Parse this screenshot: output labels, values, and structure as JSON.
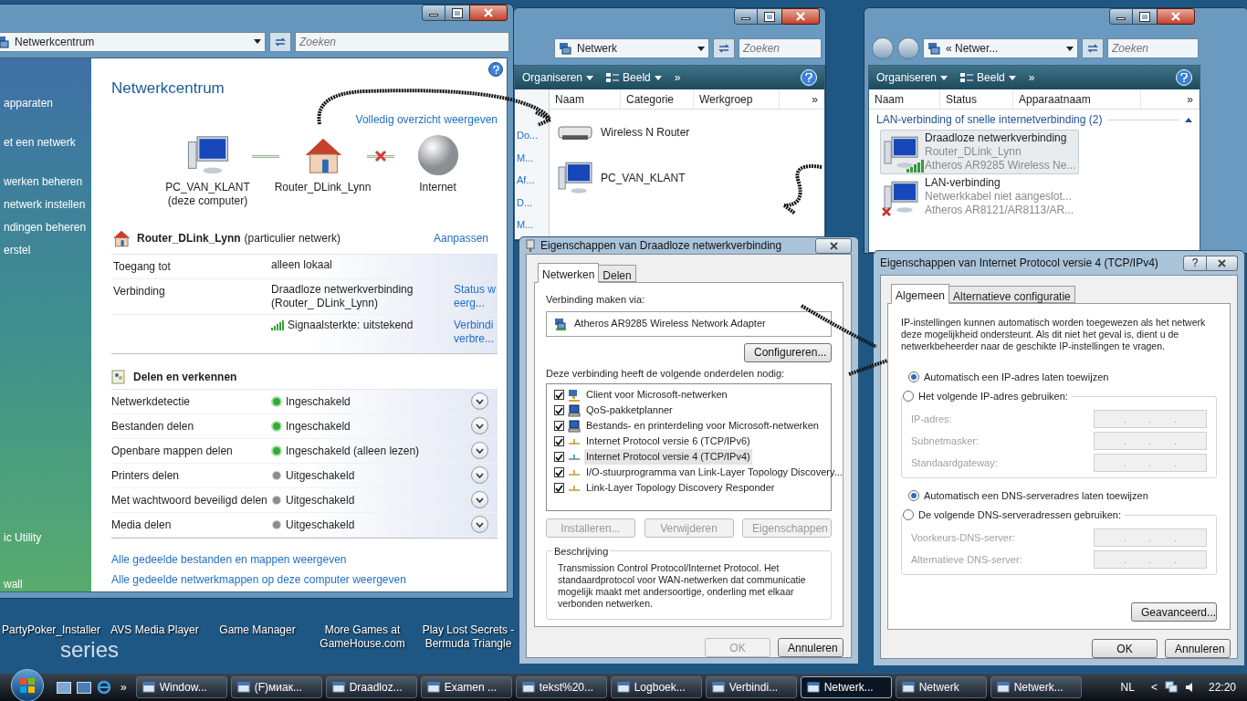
{
  "desktop": {
    "wallpaper_text": "series",
    "icons": [
      {
        "label": "PartyPoker_Installer"
      },
      {
        "label": "AVS Media Player"
      },
      {
        "label": "Game Manager"
      },
      {
        "label": "More Games at GameHouse.com"
      },
      {
        "label": "Play Lost Secrets - Bermuda Triangle"
      }
    ]
  },
  "network_center": {
    "address": "Netwerkcentrum",
    "search_placeholder": "Zoeken",
    "sidebar": [
      {
        "label": "apparaten"
      },
      {
        "label": "et een netwerk"
      },
      {
        "label": "werken beheren"
      },
      {
        "label": "netwerk instellen"
      },
      {
        "label": "ndingen beheren"
      },
      {
        "label": "erstel"
      },
      {
        "label": "ic Utility"
      },
      {
        "label": "wall"
      }
    ],
    "title": "Netwerkcentrum",
    "full_map_link": "Volledig overzicht weergeven",
    "map": [
      {
        "kind": "computer",
        "label": "PC_VAN_KLANT",
        "sublabel": "(deze computer)"
      },
      {
        "kind": "house",
        "label": "Router_DLink_Lynn",
        "link_ok": true
      },
      {
        "kind": "globe",
        "label": "Internet",
        "link_ok": false
      }
    ],
    "network": {
      "name": "Router_DLink_Lynn",
      "type": "(particulier netwerk)",
      "customize_link": "Aanpassen",
      "rows": [
        {
          "label": "Toegang tot",
          "value": "alleen lokaal"
        },
        {
          "label": "Verbinding",
          "value": "Draadloze netwerkverbinding (Router_ DLink_Lynn)",
          "link": "Status weerg..."
        },
        {
          "label": "",
          "value": "Signaalsterkte: uitstekend",
          "kind": "signal",
          "link": "Verbindi verbre..."
        }
      ]
    },
    "sharing_title": "Delen en verkennen",
    "sharing": [
      {
        "label": "Netwerkdetectie",
        "status": "Ingeschakeld",
        "on": true
      },
      {
        "label": "Bestanden delen",
        "status": "Ingeschakeld",
        "on": true
      },
      {
        "label": "Openbare mappen delen",
        "status": "Ingeschakeld (alleen lezen)",
        "on": true
      },
      {
        "label": "Printers delen",
        "status": "Uitgeschakeld",
        "on": false
      },
      {
        "label": "Met wachtwoord beveiligd delen",
        "status": "Uitgeschakeld",
        "on": false
      },
      {
        "label": "Media delen",
        "status": "Uitgeschakeld",
        "on": false
      }
    ],
    "links": [
      "Alle gedeelde bestanden en mappen weergeven",
      "Alle gedeelde netwerkmappen op deze computer weergeven"
    ]
  },
  "network_explorer": {
    "address": "Netwerk",
    "search_placeholder": "Zoeken",
    "toolbar": [
      "Organiseren",
      "Beeld",
      "»"
    ],
    "nav_items": [
      "Do...",
      "M...",
      "Af...",
      "D...",
      "M..."
    ],
    "columns": [
      "Naam",
      "Categorie",
      "Werkgroep",
      "»"
    ],
    "items": [
      {
        "kind": "router",
        "name": "Wireless N Router"
      },
      {
        "kind": "computer",
        "name": "PC_VAN_KLANT"
      }
    ]
  },
  "connections_explorer": {
    "address": "« Netwer...",
    "search_placeholder": "Zoeken",
    "toolbar": [
      "Organiseren",
      "Beeld",
      "»"
    ],
    "columns": [
      "Naam",
      "Status",
      "Apparaatnaam",
      "»"
    ],
    "group": "LAN-verbinding of snelle internetverbinding (2)",
    "items": [
      {
        "kind": "wireless",
        "name": "Draadloze netwerkverbinding",
        "line2": "Router_DLink_Lynn",
        "line3": "Atheros AR9285 Wireless Ne...",
        "selected": true,
        "connected": true
      },
      {
        "kind": "wired",
        "name": "LAN-verbinding",
        "line2": "Netwerkkabel niet aangeslot...",
        "line3": "Atheros AR8121/AR8113/AR...",
        "selected": false,
        "connected": false
      }
    ]
  },
  "adapter_dialog": {
    "title": "Eigenschappen van Draadloze netwerkverbinding",
    "tabs": [
      {
        "label": "Netwerken",
        "selected": true
      },
      {
        "label": "Delen",
        "selected": false
      }
    ],
    "connect_label": "Verbinding maken via:",
    "adapter": "Atheros AR9285 Wireless Network Adapter",
    "configure_button": "Configureren...",
    "components_label": "Deze verbinding heeft de volgende onderdelen nodig:",
    "components": [
      {
        "kind": "client",
        "label": "Client voor Microsoft-netwerken",
        "checked": true,
        "selected": false
      },
      {
        "kind": "service",
        "label": "QoS-pakketplanner",
        "checked": true,
        "selected": false
      },
      {
        "kind": "service",
        "label": "Bestands- en printerdeling voor Microsoft-netwerken",
        "checked": true,
        "selected": false
      },
      {
        "kind": "protocol",
        "label": "Internet Protocol versie 6 (TCP/IPv6)",
        "checked": true,
        "selected": false
      },
      {
        "kind": "protocol",
        "label": "Internet Protocol versie 4 (TCP/IPv4)",
        "checked": true,
        "selected": true
      },
      {
        "kind": "protocol",
        "label": "I/O-stuurprogramma van Link-Layer Topology Discovery...",
        "checked": true,
        "selected": false
      },
      {
        "kind": "protocol",
        "label": "Link-Layer Topology Discovery Responder",
        "checked": true,
        "selected": false
      }
    ],
    "buttons": [
      {
        "label": "Installeren...",
        "disabled": true
      },
      {
        "label": "Verwijderen",
        "disabled": true
      },
      {
        "label": "Eigenschappen",
        "disabled": true
      }
    ],
    "description_title": "Beschrijving",
    "description": "Transmission Control Protocol/Internet Protocol. Het standaardprotocol voor WAN-netwerken dat communicatie mogelijk maakt met andersoortige, onderling met elkaar verbonden netwerken.",
    "footer": [
      {
        "label": "OK",
        "disabled": true
      },
      {
        "label": "Annuleren",
        "disabled": false
      }
    ]
  },
  "ip_dialog": {
    "title": "Eigenschappen van Internet Protocol versie 4 (TCP/IPv4)",
    "help": "?",
    "tabs": [
      {
        "label": "Algemeen",
        "selected": true
      },
      {
        "label": "Alternatieve configuratie",
        "selected": false
      }
    ],
    "intro": "IP-instellingen kunnen automatisch worden toegewezen als het netwerk deze mogelijkheid ondersteunt. Als dit niet het geval is, dient u de netwerkbeheerder naar de geschikte IP-instellingen te vragen.",
    "groups": [
      {
        "auto": {
          "label": "Automatisch een IP-adres laten toewijzen",
          "selected": true
        },
        "manual": {
          "label": "Het volgende IP-adres gebruiken:",
          "selected": false
        },
        "fields": [
          {
            "label": "IP-adres:",
            "disabled": true
          },
          {
            "label": "Subnetmasker:",
            "disabled": true
          },
          {
            "label": "Standaardgateway:",
            "disabled": true
          }
        ]
      },
      {
        "auto": {
          "label": "Automatisch een DNS-serveradres laten toewijzen",
          "selected": true
        },
        "manual": {
          "label": "De volgende DNS-serveradressen gebruiken:",
          "selected": false
        },
        "fields": [
          {
            "label": "Voorkeurs-DNS-server:",
            "disabled": true
          },
          {
            "label": "Alternatieve DNS-server:",
            "disabled": true
          }
        ]
      }
    ],
    "advanced_button": "Geavanceerd...",
    "footer": [
      {
        "label": "OK",
        "disabled": false
      },
      {
        "label": "Annuleren",
        "disabled": false
      }
    ]
  },
  "taskbar": {
    "quick_launch_more": "»",
    "tasks": [
      {
        "label": "Window...",
        "active": false
      },
      {
        "label": "(F)миак...",
        "active": false
      },
      {
        "label": "Draadloz...",
        "active": false
      },
      {
        "label": "Examen ...",
        "active": false
      },
      {
        "label": "tekst%20...",
        "active": false
      },
      {
        "label": "Logboek...",
        "active": false
      },
      {
        "label": "Verbindi...",
        "active": false
      },
      {
        "label": "Netwerk...",
        "active": true
      },
      {
        "label": "Netwerk",
        "active": false
      },
      {
        "label": "Netwerk...",
        "active": false
      }
    ],
    "language": "NL",
    "tray_expand": "<",
    "clock": "22:20"
  }
}
